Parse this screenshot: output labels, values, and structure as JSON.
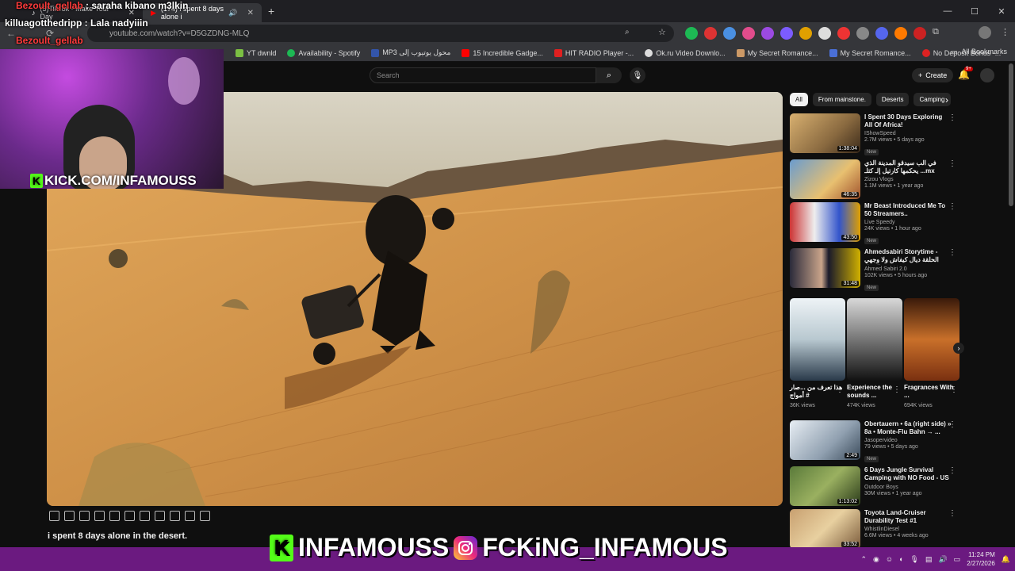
{
  "browser": {
    "tabs": [
      {
        "label": "(5)TikTok - Make Your Day",
        "active": false
      },
      {
        "label": "(174) i spent 8 days alone i",
        "active": true
      }
    ],
    "url": "youtube.com/watch?v=D5GZDNG-MLQ",
    "bookmarks": [
      "YT dwnld",
      "Availability - Spotify",
      "MP3 محول يوتيوب إلى",
      "15 Incredible Gadge...",
      "HIT RADIO Player -...",
      "Ok.ru Video Downlo...",
      "My Secret Romance...",
      "My Secret Romance...",
      "No Deposit Bonus -..."
    ],
    "all_bookmarks": "All Bookmarks"
  },
  "chat": [
    {
      "user": "Bezoult_gellab",
      "message": " : saraha kibano m3lkin",
      "color": "#ff3b3b"
    },
    {
      "user": "killuagotthedripp",
      "message": " : Lala nadyiiin",
      "color": "#ffffff"
    },
    {
      "user": "Bezoult_gellab",
      "message": "",
      "color": "#ff3b3b"
    }
  ],
  "stream": {
    "kick_url": "KICK.COM/INFAMOUSS",
    "kick_badge": "K",
    "brand_kick": "INFAMOUSS",
    "brand_ig": "FCKiNG_INFAMOUS"
  },
  "youtube": {
    "search_placeholder": "Search",
    "create_label": "Create",
    "notif_count": "9+",
    "video_title": "i spent 8 days alone in the desert.",
    "chips": [
      "All",
      "From mainstone.",
      "Deserts",
      "Camping"
    ],
    "recommendations": [
      {
        "title": "I Spent 30 Days Exploring All Of Africa!",
        "channel": "IShowSpeed",
        "meta": "2.7M views • 5 days ago",
        "duration": "1:38:04",
        "new": "New"
      },
      {
        "title": "في الب سيدقو المدينة الذي يحكمها كارتيل إلـ كتلـ  ...mx",
        "channel": "Zizou Vlogs",
        "meta": "1.1M views • 1 year ago",
        "duration": "46:35",
        "new": ""
      },
      {
        "title": "Mr Beast Introduced Me To 50 Streamers..",
        "channel": "Live Speedy",
        "meta": "24K views • 1 hour ago",
        "duration": "43:50",
        "new": "New"
      },
      {
        "title": "Ahmedsabiri Storytime - الحلقة ديال كيفاش ولا وجهي بحال هاد",
        "channel": "Ahmed Sabiri 2.0",
        "meta": "102K views • 5 hours ago",
        "duration": "31:48",
        "new": "New"
      }
    ],
    "shorts": [
      {
        "title": "هذا تعرف من ...صار أمواج #",
        "views": "36K views"
      },
      {
        "title": "Experience the sounds ...",
        "views": "474K views"
      },
      {
        "title": "Fragrances With ...",
        "views": "694K views"
      }
    ],
    "recommendations2": [
      {
        "title": "Obertauern • 6a (right side) » 8a • Monte-Flu Bahn → ...",
        "channel": "Jasopervideo",
        "meta": "79 views • 5 days ago",
        "duration": "2:49",
        "new": "New"
      },
      {
        "title": "6 Days Jungle Survival Camping with NO Food - US Marine Cor...",
        "channel": "Outdoor Boys",
        "meta": "30M views • 1 year ago",
        "duration": "1:13:02",
        "new": ""
      },
      {
        "title": "Toyota Land-Cruiser Durability Test #1",
        "channel": "WhistlinDiesel",
        "meta": "6.6M views • 4 weeks ago",
        "duration": "33:52",
        "new": ""
      }
    ]
  },
  "taskbar": {
    "time": "11:24 PM",
    "date": "2/27/2026"
  },
  "colors": {
    "kick_green": "#53fc18",
    "youtube_bg": "#0f0f0f",
    "taskbar_purple": "#6b1a80"
  }
}
